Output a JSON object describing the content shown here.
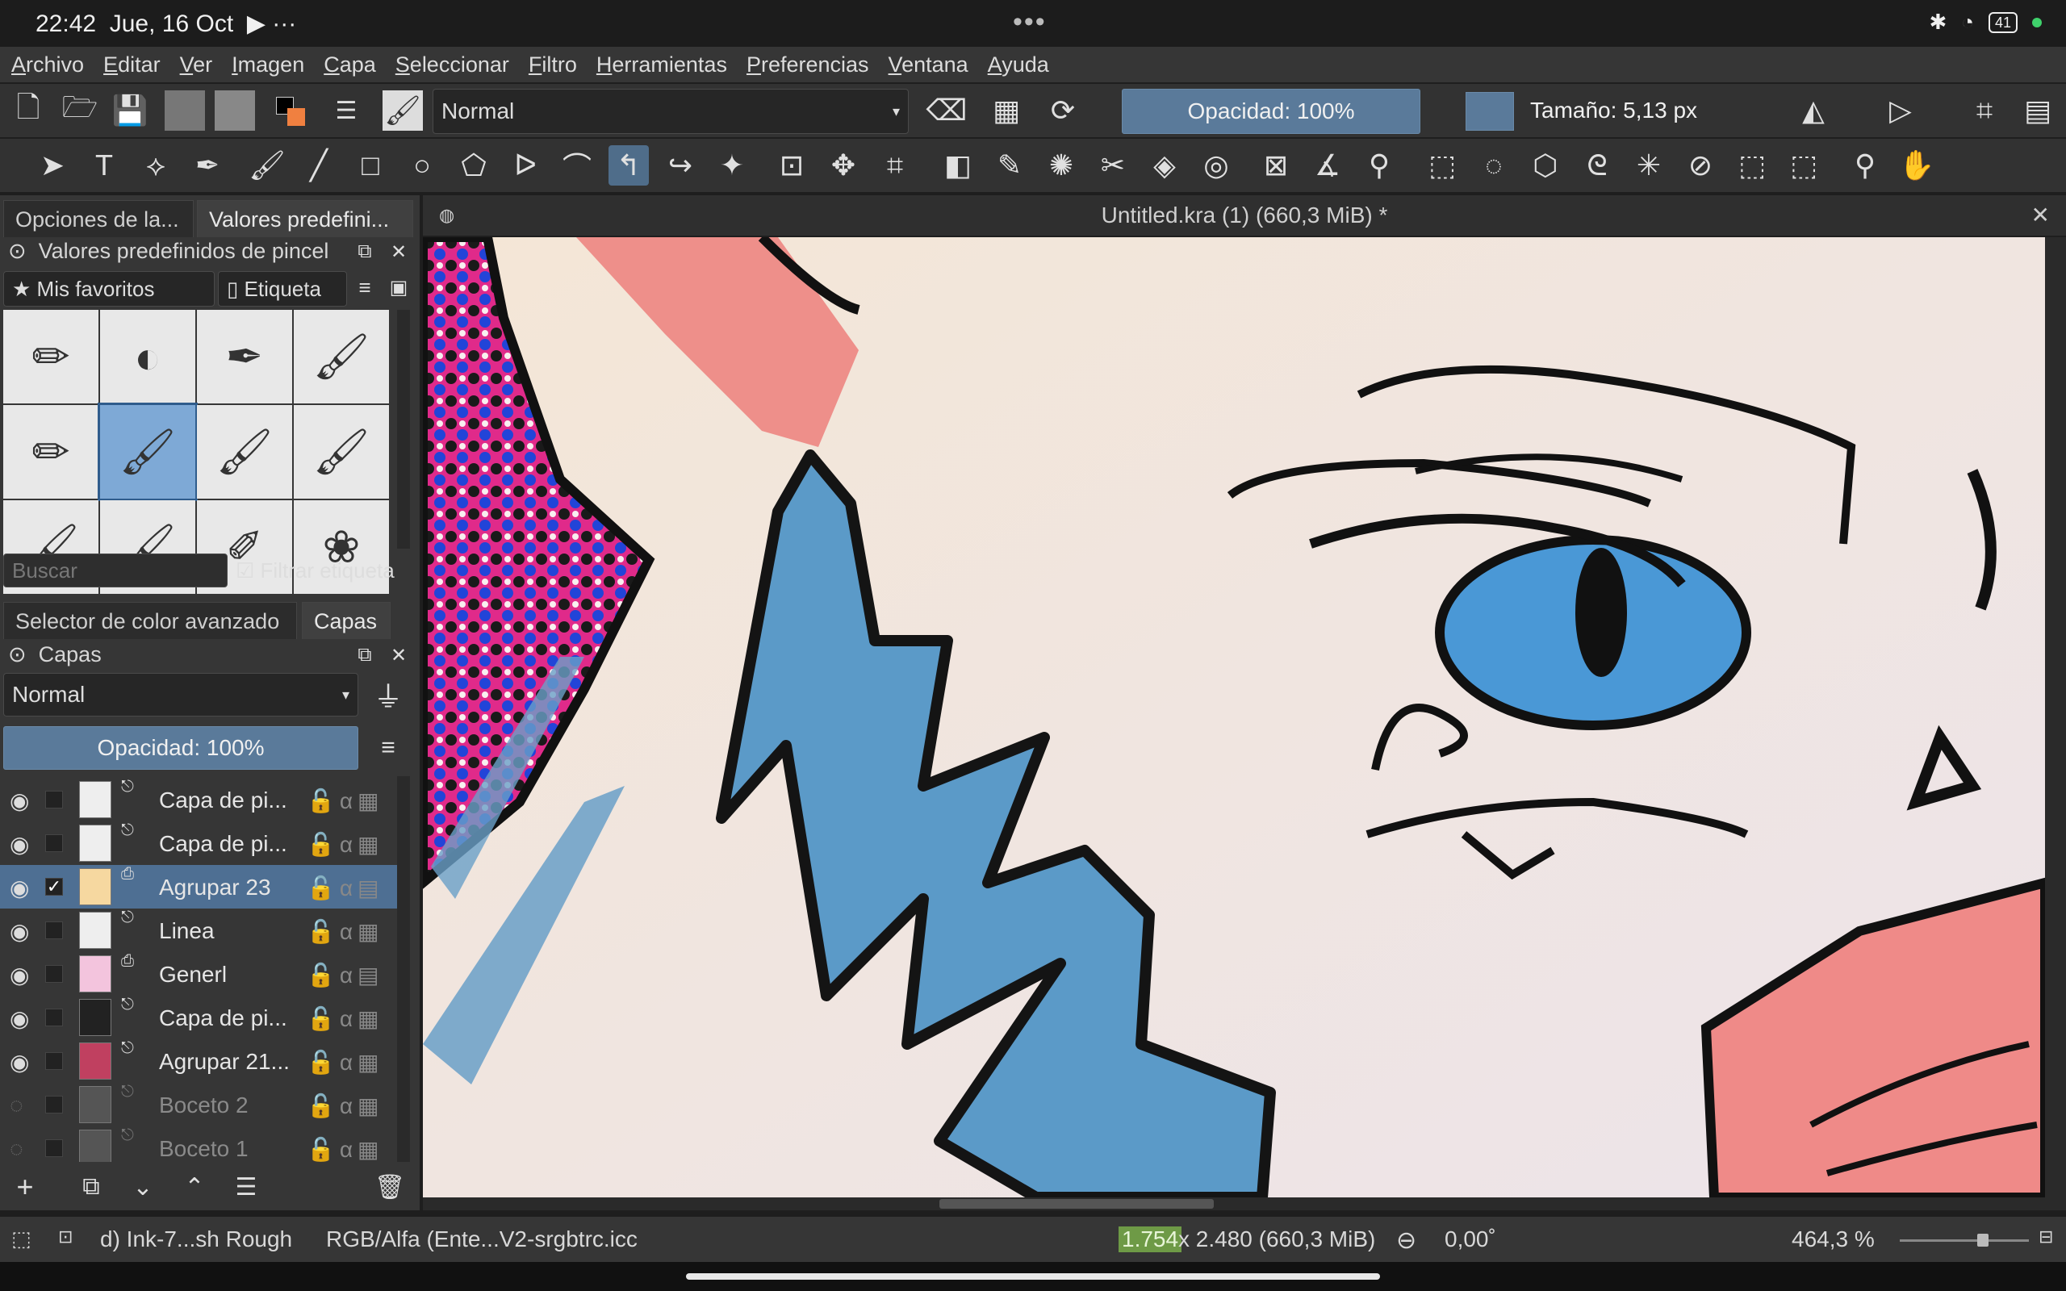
{
  "status_bar": {
    "time": "22:42",
    "date": "Jue, 16 Oct",
    "more": "•••",
    "extra": "···",
    "battery": "41"
  },
  "menu": [
    "Archivo",
    "Editar",
    "Ver",
    "Imagen",
    "Capa",
    "Seleccionar",
    "Filtro",
    "Herramientas",
    "Preferencias",
    "Ventana",
    "Ayuda"
  ],
  "toolbar": {
    "blend_mode": "Normal",
    "opacity": "Opacidad: 100%",
    "size": "Tamaño: 5,13 px"
  },
  "left_dock": {
    "tabs": [
      "Opciones de la...",
      "Valores predefini..."
    ],
    "presets_title": "Valores predefinidos de pincel",
    "favorites": "★ Mis favoritos",
    "tag": "Etiqueta",
    "search_placeholder": "Buscar",
    "filter_tag": "Filtrar etiqueta",
    "bottom_tabs": [
      "Selector de color avanzado",
      "Capas"
    ],
    "layers_title": "Capas",
    "layers_blend": "Normal",
    "layers_opacity": "Opacidad:  100%"
  },
  "layers": [
    {
      "name": "Capa de pi...",
      "visible": true,
      "checked": false,
      "selected": false
    },
    {
      "name": "Capa de pi...",
      "visible": true,
      "checked": false,
      "selected": false
    },
    {
      "name": "Agrupar 23",
      "visible": true,
      "checked": true,
      "selected": true
    },
    {
      "name": "Linea",
      "visible": true,
      "checked": false,
      "selected": false
    },
    {
      "name": "Generl",
      "visible": true,
      "checked": false,
      "selected": false
    },
    {
      "name": "Capa de pi...",
      "visible": true,
      "checked": false,
      "selected": false
    },
    {
      "name": "Agrupar 21...",
      "visible": true,
      "checked": false,
      "selected": false
    },
    {
      "name": "Boceto 2",
      "visible": false,
      "checked": false,
      "selected": false
    },
    {
      "name": "Boceto 1",
      "visible": false,
      "checked": false,
      "selected": false
    }
  ],
  "canvas": {
    "title": "Untitled.kra (1) (660,3 MiB) *"
  },
  "bottom_status": {
    "brush": "d) Ink-7...sh Rough",
    "color_space": "RGB/Alfa (Ente...V2-srgbtrc.icc",
    "dims_w": "1.754",
    "dims_rest": " x 2.480 (660,3 MiB)",
    "rotation": "0,00˚",
    "zoom": "464,3 %"
  },
  "colors": {
    "accent": "#4e6f93",
    "background": "#363636"
  }
}
